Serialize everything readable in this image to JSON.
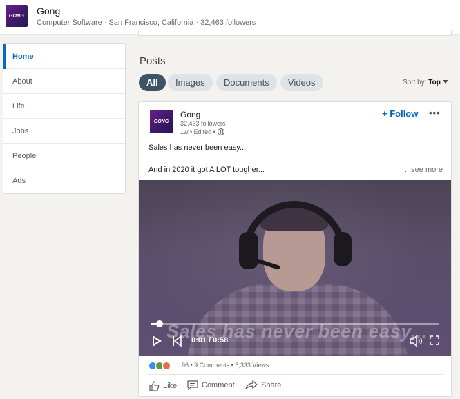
{
  "header": {
    "logo_text": "GONG",
    "company_name": "Gong",
    "meta": "Computer Software · San Francisco, California · 32,463 followers"
  },
  "nav": {
    "items": [
      {
        "label": "Home",
        "active": true
      },
      {
        "label": "About"
      },
      {
        "label": "Life"
      },
      {
        "label": "Jobs"
      },
      {
        "label": "People"
      },
      {
        "label": "Ads"
      }
    ]
  },
  "posts": {
    "title": "Posts",
    "filters": [
      "All",
      "Images",
      "Documents",
      "Videos"
    ],
    "sort_label": "Sort by:",
    "sort_value": "Top"
  },
  "post": {
    "logo_text": "GONG",
    "author": "Gong",
    "followers": "32,463 followers",
    "time": "1w • Edited •",
    "follow_label": "+ Follow",
    "more_label": "•••",
    "text_line1": "Sales has never been easy...",
    "text_line2": "And in 2020 it got A LOT tougher...",
    "see_more": "...see more",
    "video": {
      "caption": "Sales has never been easy...",
      "timecode": "0:01 / 0:58",
      "progress": 0.03
    },
    "social": "96 • 9 Comments • 5,333 Views",
    "actions": [
      "Like",
      "Comment",
      "Share"
    ]
  },
  "colors": {
    "accent": "#0a66c2",
    "pill_active": "#3d5366",
    "brand_purple": "#3d1a66"
  }
}
